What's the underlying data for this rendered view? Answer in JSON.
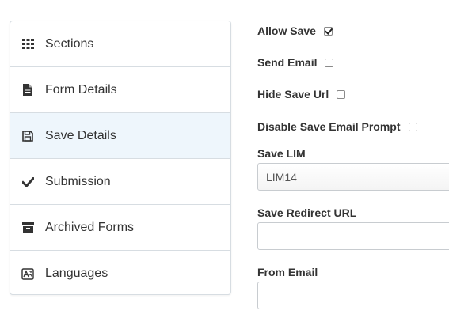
{
  "sidebar": {
    "items": [
      {
        "label": "Sections",
        "icon": "grid-icon"
      },
      {
        "label": "Form Details",
        "icon": "document-icon"
      },
      {
        "label": "Save Details",
        "icon": "floppy-disk-icon",
        "active": true
      },
      {
        "label": "Submission",
        "icon": "checkmark-icon"
      },
      {
        "label": "Archived Forms",
        "icon": "archive-box-icon"
      },
      {
        "label": "Languages",
        "icon": "language-icon"
      }
    ]
  },
  "form": {
    "allow_save": {
      "label": "Allow Save",
      "checked": true
    },
    "send_email": {
      "label": "Send Email",
      "checked": false
    },
    "hide_save_url": {
      "label": "Hide Save Url",
      "checked": false
    },
    "disable_save_email_prompt": {
      "label": "Disable Save Email Prompt",
      "checked": false
    },
    "save_lim": {
      "label": "Save LIM",
      "value": "LIM14"
    },
    "save_redirect_url": {
      "label": "Save Redirect URL",
      "value": ""
    },
    "from_email": {
      "label": "From Email",
      "value": ""
    }
  },
  "colors": {
    "active_item_bg": "#eef6fc",
    "border": "#d7dde2",
    "text": "#333333"
  }
}
